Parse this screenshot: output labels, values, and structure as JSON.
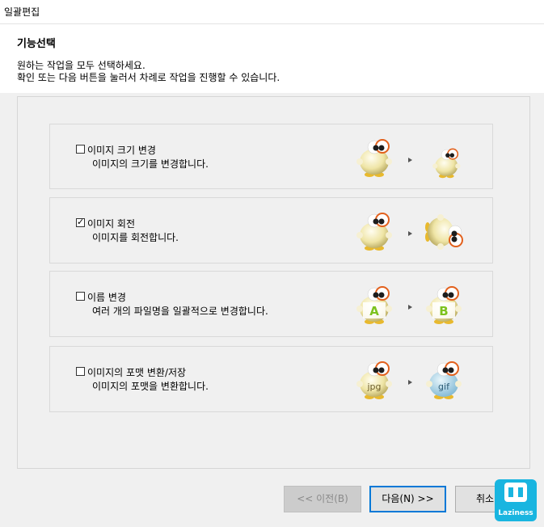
{
  "window": {
    "title": "일괄편집"
  },
  "header": {
    "section_title": "기능선택",
    "desc_line1": "원하는 작업을 모두 선택하세요.",
    "desc_line2": "확인 또는 다음 버튼을 눌러서 차례로 작업을 진행할 수 있습니다."
  },
  "options": [
    {
      "label": "이미지 크기 변경",
      "description": "이미지의 크기를 변경합니다.",
      "checked": false,
      "icon": "resize-mascot-icon"
    },
    {
      "label": "이미지 회전",
      "description": "이미지를 회전합니다.",
      "checked": true,
      "icon": "rotate-mascot-icon"
    },
    {
      "label": "이름 변경",
      "description": "여러 개의 파일명을 일괄적으로 변경합니다.",
      "checked": false,
      "icon": "rename-mascot-icon",
      "from_text": "A",
      "to_text": "B"
    },
    {
      "label": "이미지의 포맷 변환/저장",
      "description": "이미지의 포맷을 변환합니다.",
      "checked": false,
      "icon": "format-mascot-icon",
      "from_text": "jpg",
      "to_text": "gif"
    }
  ],
  "buttons": {
    "prev": "<< 이전(B)",
    "next": "다음(N) >>",
    "cancel": "취소"
  },
  "badge": {
    "text": "Laziness"
  },
  "colors": {
    "accent": "#0078d7",
    "mascot_body": "#f1e9b0",
    "eye_ring": "#e2601c",
    "letter_green": "#7cc21d",
    "badge_blue": "#19b5e0"
  }
}
